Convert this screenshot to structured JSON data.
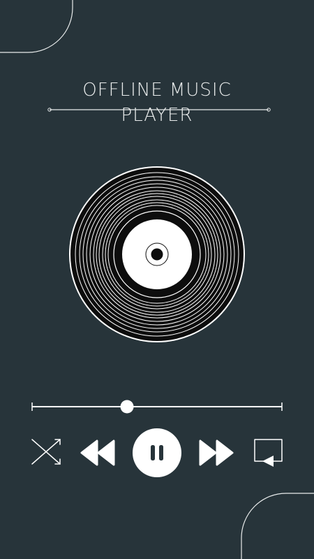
{
  "title": {
    "line1": "OFFLINE MUSIC",
    "line2": "PLAYER"
  },
  "playback": {
    "progress_fraction": 0.38,
    "state": "playing"
  },
  "controls": {
    "shuffle_icon": "shuffle-icon",
    "previous_icon": "rewind-icon",
    "play_pause_icon": "pause-icon",
    "next_icon": "fast-forward-icon",
    "repeat_icon": "repeat-icon"
  },
  "colors": {
    "background": "#27343a",
    "foreground": "#ffffff",
    "record": "#0d0d0d"
  }
}
